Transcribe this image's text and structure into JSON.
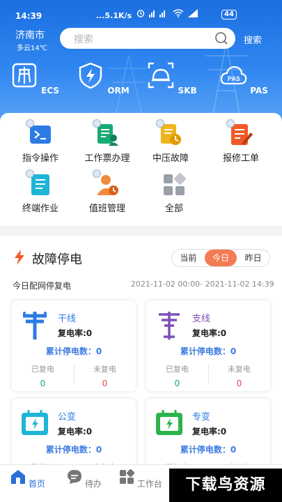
{
  "status": {
    "time": "14:39",
    "net": "...5.1K/s",
    "battery": "44"
  },
  "header": {
    "city": "济南市",
    "weather": "多云14℃",
    "search_placeholder": "搜索",
    "search_button": "搜索"
  },
  "top_apps": [
    {
      "label": "ECS",
      "icon": "substation-icon"
    },
    {
      "label": "ORM",
      "icon": "shield-lightning-icon"
    },
    {
      "label": "SKB",
      "icon": "helmet-scan-icon"
    },
    {
      "label": "PAS",
      "icon": "cloud-icon"
    }
  ],
  "grid": [
    {
      "label": "指令操作",
      "icon": "terminal-icon",
      "color": "#2c7be5"
    },
    {
      "label": "工作票办理",
      "icon": "ticket-user-icon",
      "color": "#19a974"
    },
    {
      "label": "中压故障",
      "icon": "fault-clock-icon",
      "color": "#f0b41c"
    },
    {
      "label": "报修工单",
      "icon": "edit-order-icon",
      "color": "#ef5a28"
    },
    {
      "label": "终端作业",
      "icon": "document-icon",
      "color": "#1fb5d6"
    },
    {
      "label": "值班管理",
      "icon": "duty-person-icon",
      "color": "#f08a3c"
    },
    {
      "label": "全部",
      "icon": "all-apps-icon",
      "color": "#9aa0a8"
    }
  ],
  "fault": {
    "title": "故障停电",
    "tabs": [
      "当前",
      "今日",
      "昨日"
    ],
    "active_tab": "今日",
    "subtitle": "今日配网停复电",
    "range": "2021-11-02 00:00- 2021-11-02 14:39",
    "cards": [
      {
        "name": "干线",
        "name_color": "#2c7be5",
        "rate_label": "复电率:0",
        "cum_label": "累计停电数：0",
        "restored_label": "已复电",
        "restored": "0",
        "unrestored_label": "未复电",
        "unrestored": "0"
      },
      {
        "name": "支线",
        "name_color": "#7b4fb8",
        "rate_label": "复电率:0",
        "cum_label": "累计停电数：0",
        "restored_label": "已复电",
        "restored": "0",
        "unrestored_label": "未复电",
        "unrestored": "0"
      },
      {
        "name": "公变",
        "name_color": "#2c7be5",
        "rate_label": "复电率:0",
        "cum_label": "累计停电数：0",
        "restored_label": "已复电",
        "restored": "",
        "unrestored_label": "未复电",
        "unrestored": ""
      },
      {
        "name": "专变",
        "name_color": "#2c7be5",
        "rate_label": "复电率:0",
        "cum_label": "累计停电数：0",
        "restored_label": "已复电",
        "restored": "",
        "unrestored_label": "未复电",
        "unrestored": ""
      }
    ]
  },
  "nav": [
    {
      "label": "首页",
      "icon": "home-icon",
      "active": true
    },
    {
      "label": "待办",
      "icon": "chat-icon",
      "active": false
    },
    {
      "label": "工作台",
      "icon": "workbench-icon",
      "active": false
    }
  ],
  "watermark": "下载鸟资源",
  "colors": {
    "accent": "#2a6fd8",
    "tab_active": "#f47c55",
    "restored": "#19a974",
    "unrestored": "#e5484d"
  }
}
